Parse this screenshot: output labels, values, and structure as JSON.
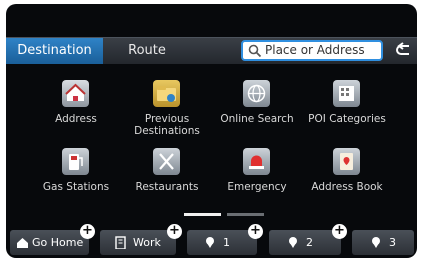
{
  "tabs": {
    "destination": "Destination",
    "route": "Route"
  },
  "search": {
    "placeholder": "Place or Address"
  },
  "menu": [
    {
      "label": "Address",
      "icon": "house-icon"
    },
    {
      "label": "Previous Destinations",
      "icon": "folder-icon"
    },
    {
      "label": "Online Search",
      "icon": "globe-icon"
    },
    {
      "label": "POI Categories",
      "icon": "building-icon"
    },
    {
      "label": "Gas Stations",
      "icon": "gas-pump-icon"
    },
    {
      "label": "Restaurants",
      "icon": "fork-knife-icon"
    },
    {
      "label": "Emergency",
      "icon": "siren-icon"
    },
    {
      "label": "Address Book",
      "icon": "book-icon"
    }
  ],
  "shortcuts": [
    {
      "label": "Go Home",
      "icon": "home-icon"
    },
    {
      "label": "Work",
      "icon": "office-icon"
    },
    {
      "label": "1",
      "icon": "favorite-pin-icon"
    },
    {
      "label": "2",
      "icon": "favorite-pin-icon"
    },
    {
      "label": "3",
      "icon": "favorite-pin-icon"
    }
  ],
  "colors": {
    "accent": "#2f83c7",
    "background": "#07090c"
  }
}
